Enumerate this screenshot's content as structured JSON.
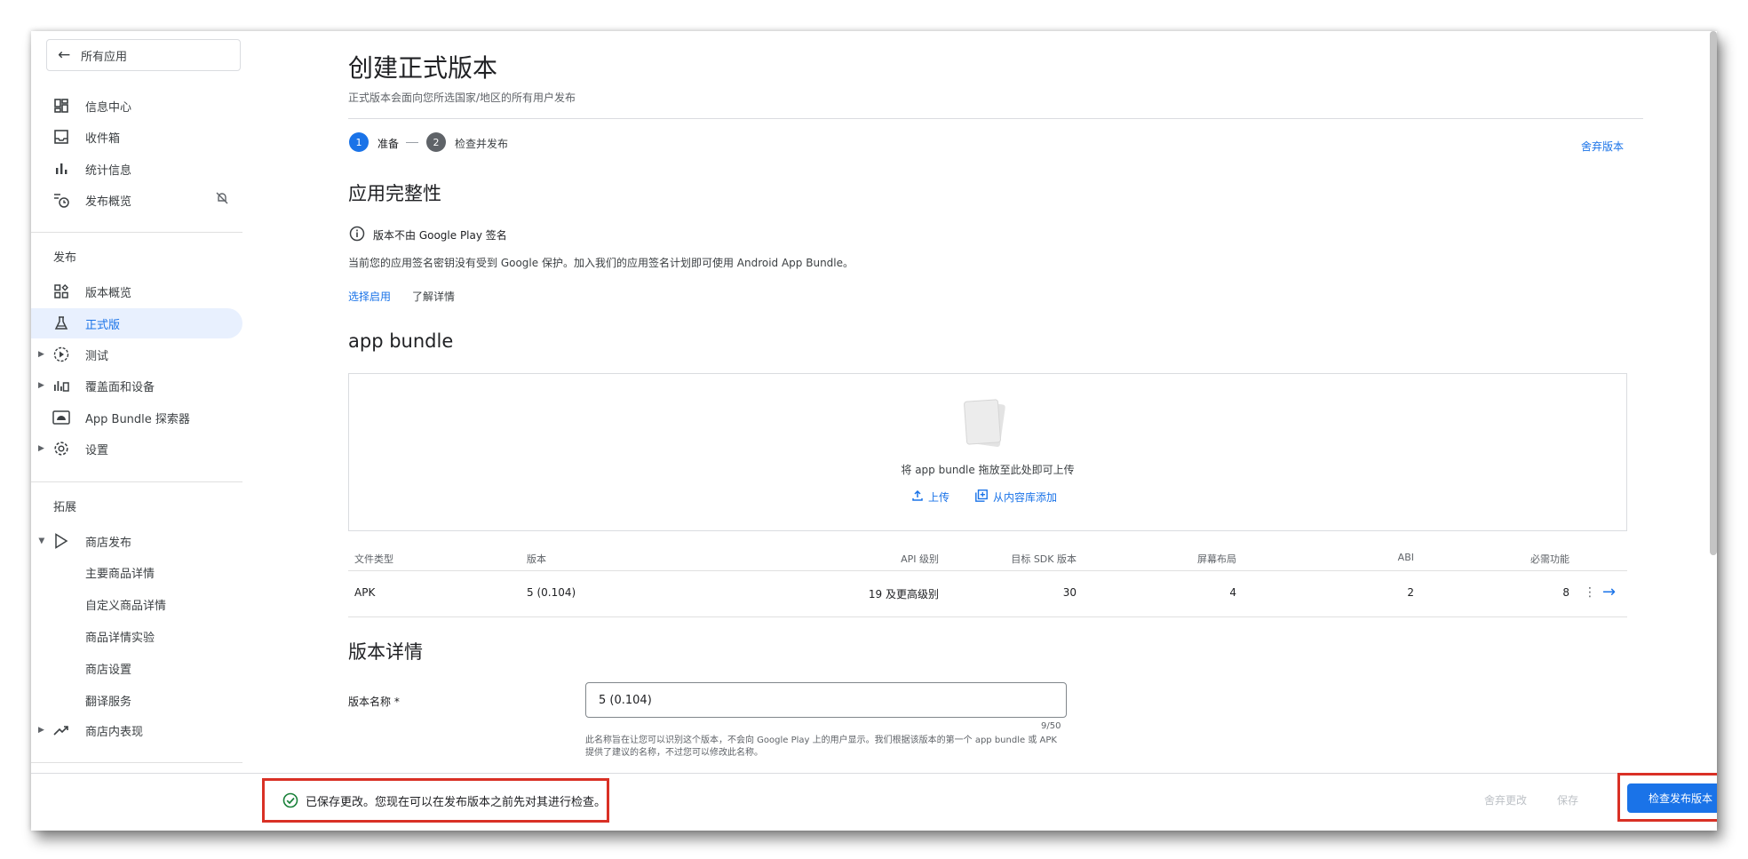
{
  "sidebar": {
    "back_label": "所有应用",
    "items_top": [
      {
        "label": "信息中心",
        "icon": "dashboard-icon"
      },
      {
        "label": "收件箱",
        "icon": "inbox-icon"
      },
      {
        "label": "统计信息",
        "icon": "bar-chart-icon"
      },
      {
        "label": "发布概览",
        "icon": "publish-overview-icon"
      }
    ],
    "section_publish": "发布",
    "items_publish": [
      {
        "label": "版本概览",
        "icon": "release-overview-icon"
      },
      {
        "label": "正式版",
        "icon": "production-icon"
      },
      {
        "label": "测试",
        "icon": "testing-icon"
      },
      {
        "label": "覆盖面和设备",
        "icon": "reach-devices-icon"
      },
      {
        "label": "App Bundle 探索器",
        "icon": "bundle-explorer-icon"
      },
      {
        "label": "设置",
        "icon": "settings-icon"
      }
    ],
    "section_grow": "拓展",
    "store_label": "商店发布",
    "store_subitems": [
      "主要商品详情",
      "自定义商品详情",
      "商品详情实验",
      "商店设置",
      "翻译服务"
    ],
    "store_perf_label": "商店内表现"
  },
  "main": {
    "title": "创建正式版本",
    "subtitle": "正式版本会面向您所选国家/地区的所有用户发布",
    "steps": [
      {
        "num": "1",
        "label": "准备"
      },
      {
        "num": "2",
        "label": "检查并发布"
      }
    ],
    "discard_release": "舍弃版本",
    "integrity": {
      "heading": "应用完整性",
      "notice": "版本不由 Google Play 签名",
      "desc": "当前您的应用签名密钥没有受到 Google 保护。加入我们的应用签名计划即可使用 Android App Bundle。",
      "enable_link": "选择启用",
      "learn_link": "了解详情"
    },
    "bundle": {
      "heading": "app bundle",
      "drop_text": "将 app bundle 拖放至此处即可上传",
      "upload_label": "上传",
      "library_label": "从内容库添加"
    },
    "table": {
      "headers": [
        "文件类型",
        "版本",
        "API 级别",
        "目标 SDK 版本",
        "屏幕布局",
        "ABI",
        "必需功能"
      ],
      "row": [
        "APK",
        "5 (0.104)",
        "19 及更高级别",
        "30",
        "4",
        "2",
        "8"
      ]
    },
    "details": {
      "heading": "版本详情",
      "name_label": "版本名称 *",
      "name_value": "5 (0.104)",
      "counter": "9/50",
      "helper": "此名称旨在让您可以识别这个版本，不会向 Google Play 上的用户显示。我们根据该版本的第一个 app bundle 或 APK 提供了建议的名称，不过您可以修改此名称。"
    }
  },
  "bottom": {
    "saved_message": "已保存更改。您现在可以在发布版本之前先对其进行检查。",
    "discard_changes": "舍弃更改",
    "save": "保存",
    "review_release": "检查发布版本"
  },
  "colors": {
    "accent": "#1a73e8",
    "highlight_border": "#d93025",
    "active_bg": "#e8f0fe"
  }
}
